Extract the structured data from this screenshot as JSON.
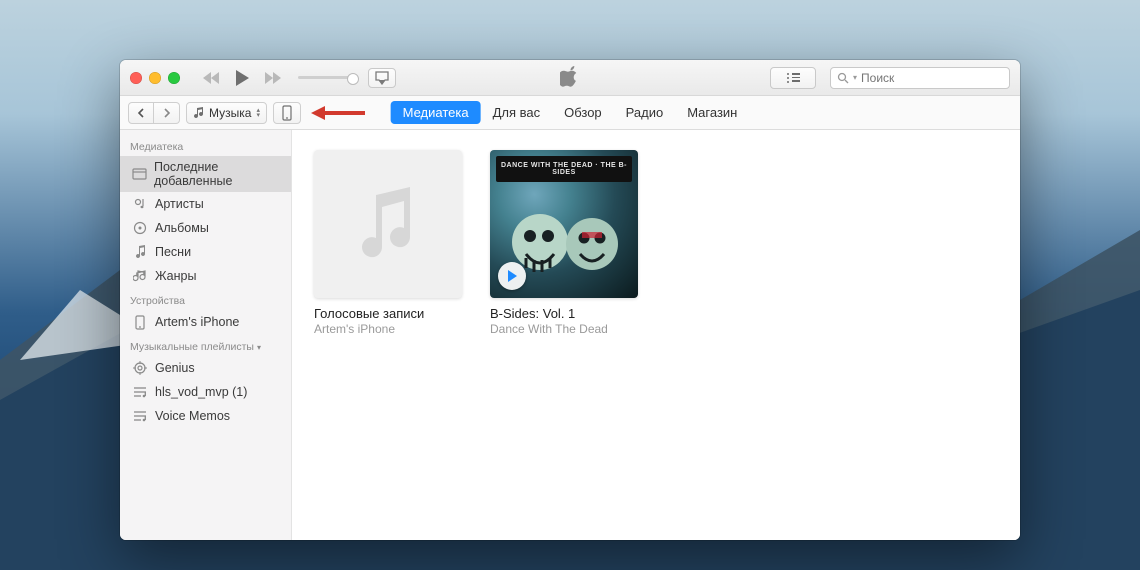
{
  "toolbar": {
    "media_selector_label": "Музыка",
    "search_placeholder": "Поиск"
  },
  "tabs": {
    "items": [
      "Медиатека",
      "Для вас",
      "Обзор",
      "Радио",
      "Магазин"
    ],
    "active_index": 0
  },
  "sidebar": {
    "sections": [
      {
        "title": "Медиатека",
        "collapsible": false,
        "items": [
          {
            "icon": "recent",
            "label": "Последние добавленные",
            "selected": true
          },
          {
            "icon": "artist",
            "label": "Артисты",
            "selected": false
          },
          {
            "icon": "album",
            "label": "Альбомы",
            "selected": false
          },
          {
            "icon": "song",
            "label": "Песни",
            "selected": false
          },
          {
            "icon": "genre",
            "label": "Жанры",
            "selected": false
          }
        ]
      },
      {
        "title": "Устройства",
        "collapsible": false,
        "items": [
          {
            "icon": "phone",
            "label": "Artem's iPhone",
            "selected": false
          }
        ]
      },
      {
        "title": "Музыкальные плейлисты",
        "collapsible": true,
        "items": [
          {
            "icon": "genius",
            "label": "Genius",
            "selected": false
          },
          {
            "icon": "playlist",
            "label": "hls_vod_mvp (1)",
            "selected": false
          },
          {
            "icon": "playlist",
            "label": "Voice Memos",
            "selected": false
          }
        ]
      }
    ]
  },
  "albums": [
    {
      "art": "blank",
      "title": "Голосовые записи",
      "subtitle": "Artem's iPhone",
      "play_overlay": false
    },
    {
      "art": "bsides",
      "title": "B-Sides: Vol. 1",
      "subtitle": "Dance With The Dead",
      "play_overlay": true,
      "banner_text": "DANCE WITH THE DEAD · THE B-SIDES"
    }
  ],
  "colors": {
    "accent": "#1e8bff",
    "annotation_arrow": "#d23a2e"
  }
}
